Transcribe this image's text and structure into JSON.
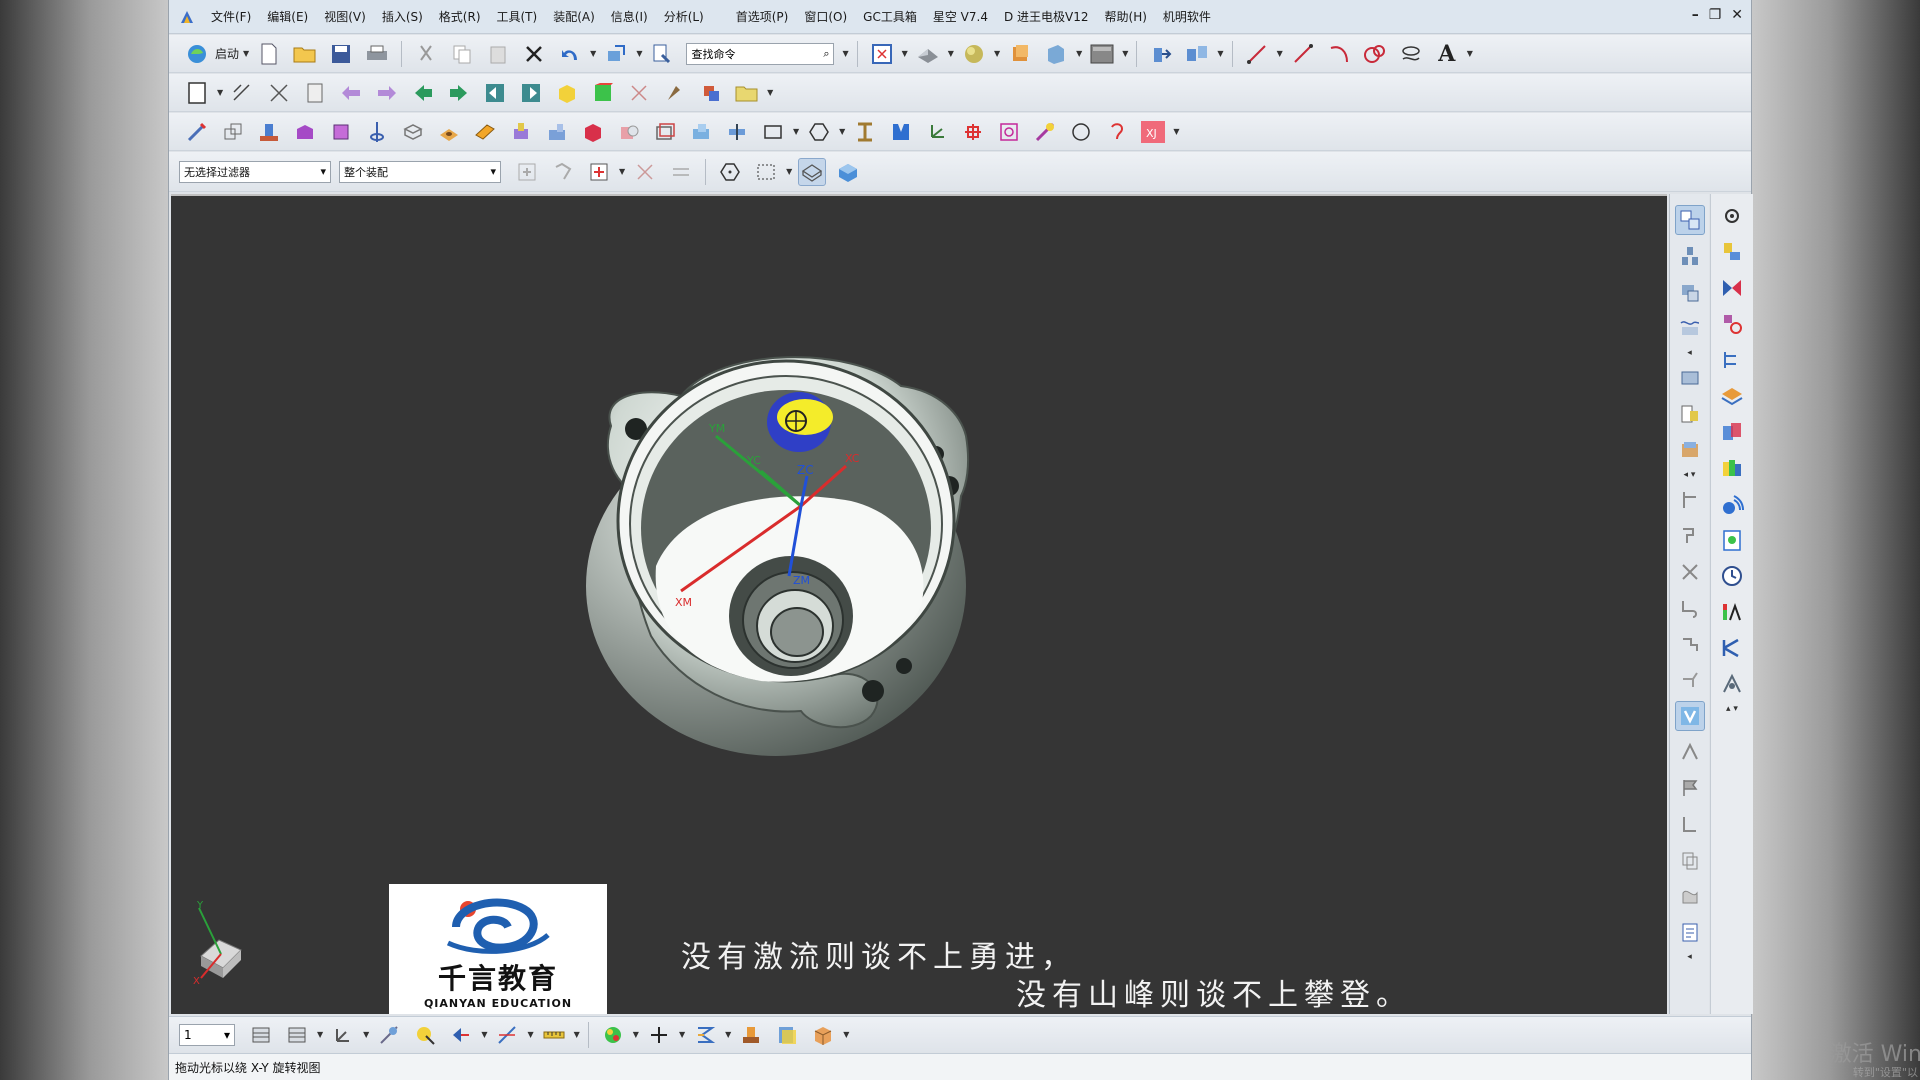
{
  "menu": {
    "items": [
      "文件(F)",
      "编辑(E)",
      "视图(V)",
      "插入(S)",
      "格式(R)",
      "工具(T)",
      "装配(A)",
      "信息(I)",
      "分析(L)",
      "首选项(P)",
      "窗口(O)",
      "GC工具箱",
      "星空 V7.4",
      "D 进王电极V12",
      "帮助(H)",
      "机明软件"
    ]
  },
  "toolbar1": {
    "start_label": "启动",
    "command_search_placeholder": "查找命令",
    "text_tool_label": "A"
  },
  "toolbar4": {
    "selection_filter": "无选择过滤器",
    "assembly_scope": "整个装配"
  },
  "viewport": {
    "csys_labels": {
      "ym": "YM",
      "yc": "YC",
      "zc": "ZC",
      "xc": "XC",
      "xm": "XM",
      "zm": "ZM"
    },
    "triad_labels": {
      "y": "Y",
      "x": "X"
    }
  },
  "logo": {
    "name_cn": "千言教育",
    "name_en": "QIANYAN EDUCATION"
  },
  "subtitle": {
    "line1": "没有激流则谈不上勇进，",
    "line2": "没有山峰则谈不上攀登。"
  },
  "bottom_toolbar": {
    "layer": "1"
  },
  "status": {
    "message": "拖动光标以绕 X-Y 旋转视图"
  },
  "watermark": {
    "line1": "激活 Win",
    "line2": "转到\"设置\"以"
  },
  "colors": {
    "viewport_bg": "#353535",
    "model_body": "#dfe7e1",
    "highlight_yellow": "#f4ec2a",
    "highlight_blue": "#2f3fc6",
    "axis_red": "#d92c2c",
    "axis_green": "#2aa13a",
    "axis_blue": "#2050d8"
  }
}
